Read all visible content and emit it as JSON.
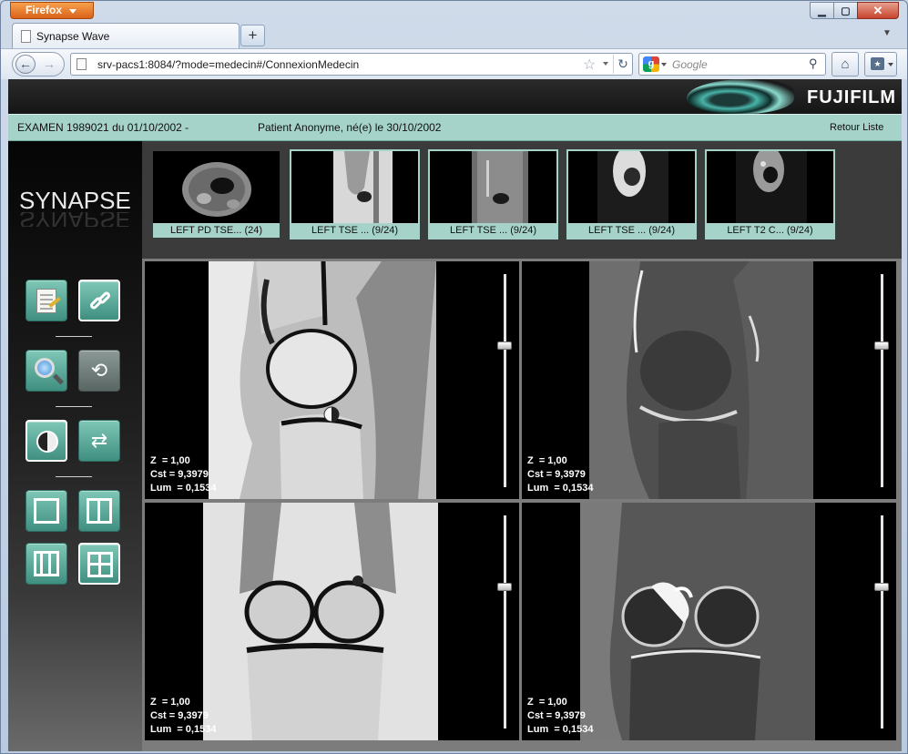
{
  "browser": {
    "menu_button": "Firefox",
    "window_controls": {
      "minimize": "▁",
      "maximize": "▢",
      "close": "✕"
    },
    "tab_title": "Synapse Wave",
    "new_tab": "+",
    "url": "srv-pacs1:8084/?mode=medecin#/ConnexionMedecin",
    "search_engine_glyph": "g",
    "search_placeholder": "Google"
  },
  "app": {
    "brand": "FUJIFILM",
    "exam_info": "EXAMEN 1989021 du 01/10/2002   -",
    "patient_info": "Patient Anonyme, né(e) le 30/10/2002",
    "back_link": "Retour Liste",
    "product_logo": "SYNAPSE"
  },
  "toolbar": {
    "buttons": [
      {
        "icon": "report-icon",
        "state": "normal"
      },
      {
        "icon": "link-icon",
        "state": "active"
      },
      {
        "icon": "magnifier-icon",
        "state": "normal"
      },
      {
        "icon": "rotate-icon",
        "state": "disabled"
      },
      {
        "icon": "contrast-icon",
        "state": "active"
      },
      {
        "icon": "sync-icon",
        "state": "normal"
      },
      {
        "icon": "layout-1x1-icon",
        "state": "normal"
      },
      {
        "icon": "layout-2x1-icon",
        "state": "normal"
      },
      {
        "icon": "layout-3x1-icon",
        "state": "normal"
      },
      {
        "icon": "layout-2x2-icon",
        "state": "active"
      }
    ]
  },
  "series": [
    {
      "label": "LEFT PD TSE... (24)"
    },
    {
      "label": "LEFT TSE ... (9/24)"
    },
    {
      "label": "LEFT TSE ... (9/24)"
    },
    {
      "label": "LEFT TSE ... (9/24)"
    },
    {
      "label": "LEFT T2 C... (9/24)"
    }
  ],
  "viewports": [
    {
      "zoom": "Z  = 1,00",
      "contrast": "Cst = 9,3979",
      "luminance": "Lum  = 0,1534",
      "level": 0.3,
      "selected": true
    },
    {
      "zoom": "Z  = 1,00",
      "contrast": "Cst = 9,3979",
      "luminance": "Lum  = 0,1534",
      "level": 0.3,
      "selected": false
    },
    {
      "zoom": "Z  = 1,00",
      "contrast": "Cst = 9,3979",
      "luminance": "Lum  = 0,1534",
      "level": 0.3,
      "selected": false
    },
    {
      "zoom": "Z  = 1,00",
      "contrast": "Cst = 9,3979",
      "luminance": "Lum  = 0,1534",
      "level": 0.3,
      "selected": false
    }
  ],
  "colors": {
    "accent": "#a6d3c9",
    "button": "#5faa9b",
    "brand_red": "#e23a3a"
  }
}
